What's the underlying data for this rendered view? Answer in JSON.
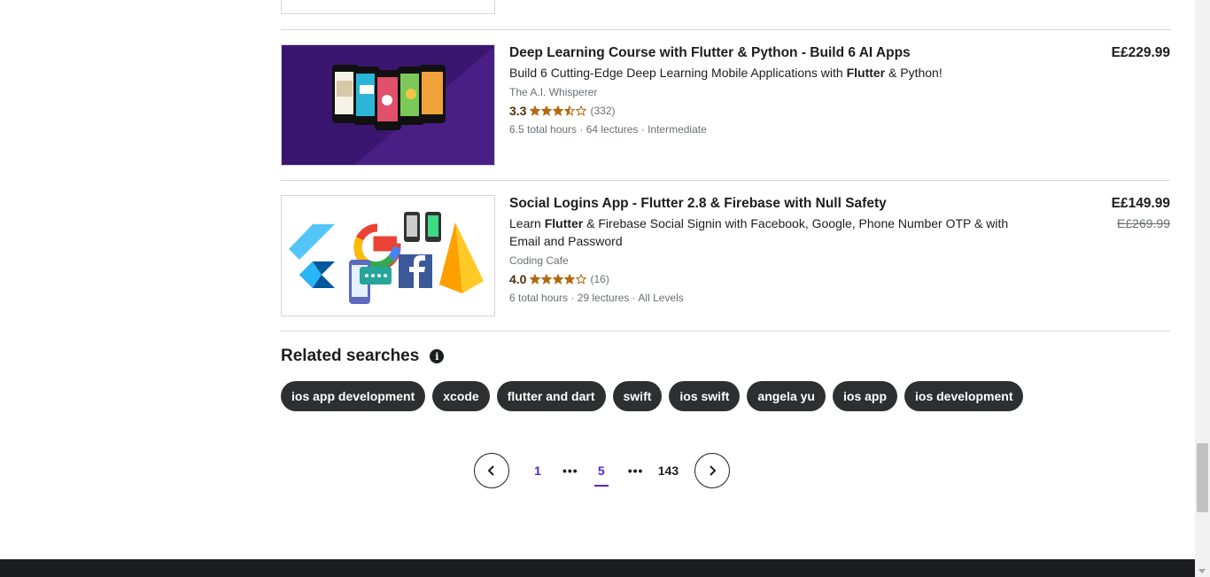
{
  "courses": [
    {
      "title": "Deep Learning Course with Flutter & Python - Build 6 AI Apps",
      "headline_pre": "Build 6 Cutting-Edge Deep Learning Mobile Applications with ",
      "headline_bold": "Flutter",
      "headline_post": " & Python!",
      "author": "The A.I. Whisperer",
      "rating": "3.3",
      "rating_value": 3.3,
      "review_count": "(332)",
      "meta": "6.5 total hours · 64 lectures · Intermediate",
      "price": "E£229.99",
      "old_price": ""
    },
    {
      "title": "Social Logins App - Flutter 2.8 & Firebase with Null Safety",
      "headline_pre": "Learn ",
      "headline_bold": "Flutter",
      "headline_post": " & Firebase Social Signin with Facebook, Google, Phone Number OTP & with Email and Password",
      "author": "Coding Cafe",
      "rating": "4.0",
      "rating_value": 4.0,
      "review_count": "(16)",
      "meta": "6 total hours · 29 lectures · All Levels",
      "price": "E£149.99",
      "old_price": "E£269.99"
    }
  ],
  "related": {
    "title": "Related searches",
    "info_icon": "i",
    "chips": [
      "ios app development",
      "xcode",
      "flutter and dart",
      "swift",
      "ios swift",
      "angela yu",
      "ios app",
      "ios development"
    ]
  },
  "pagination": {
    "first": "1",
    "current": "5",
    "last": "143",
    "ellipsis": "•••"
  },
  "colors": {
    "accent": "#5624d0",
    "chip_bg": "#2d2f31",
    "star": "#b4690e",
    "thumb1_bg": "#3b1670"
  }
}
